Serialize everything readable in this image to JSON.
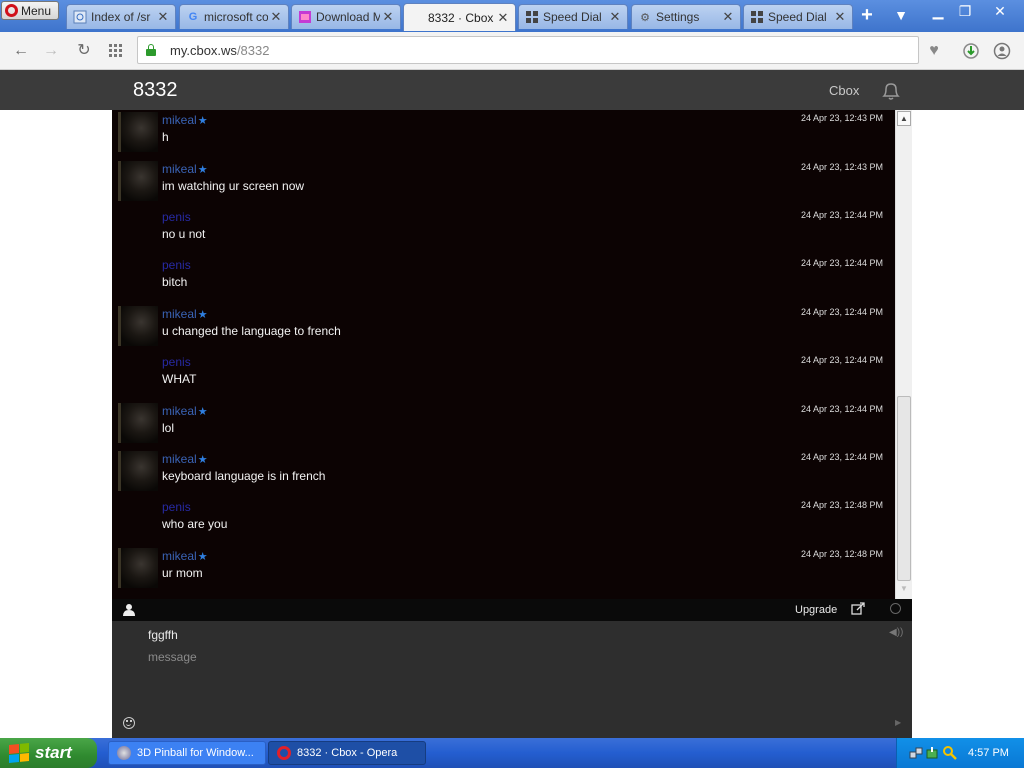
{
  "browser": {
    "menu_label": "Menu",
    "tabs": [
      {
        "title": "Index of /sr",
        "icon": "ie-page-icon"
      },
      {
        "title": "microsoft co",
        "icon": "google-icon"
      },
      {
        "title": "Download M",
        "icon": "download-page-icon"
      },
      {
        "title": "8332 · Cbox",
        "icon": "none"
      },
      {
        "title": "Speed Dial",
        "icon": "speed-dial-icon"
      },
      {
        "title": "Settings",
        "icon": "gear-icon"
      },
      {
        "title": "Speed Dial",
        "icon": "speed-dial-icon"
      }
    ],
    "url_host": "my.cbox.ws",
    "url_path": "/8332"
  },
  "cbox": {
    "box_title": "8332",
    "brand_link": "Cbox",
    "messages": [
      {
        "user": "mikeal",
        "registered": true,
        "text": "h",
        "time": "24 Apr 23, 12:43 PM"
      },
      {
        "user": "mikeal",
        "registered": true,
        "text": "im watching ur screen now",
        "time": "24 Apr 23, 12:43 PM"
      },
      {
        "user": "penis",
        "registered": false,
        "text": "no u not",
        "time": "24 Apr 23, 12:44 PM"
      },
      {
        "user": "penis",
        "registered": false,
        "text": "bitch",
        "time": "24 Apr 23, 12:44 PM"
      },
      {
        "user": "mikeal",
        "registered": true,
        "text": "u changed the language to french",
        "time": "24 Apr 23, 12:44 PM"
      },
      {
        "user": "penis",
        "registered": false,
        "text": "WHAT",
        "time": "24 Apr 23, 12:44 PM"
      },
      {
        "user": "mikeal",
        "registered": true,
        "text": "lol",
        "time": "24 Apr 23, 12:44 PM"
      },
      {
        "user": "mikeal",
        "registered": true,
        "text": "keyboard language is in french",
        "time": "24 Apr 23, 12:44 PM"
      },
      {
        "user": "penis",
        "registered": false,
        "text": "who are you",
        "time": "24 Apr 23, 12:48 PM"
      },
      {
        "user": "mikeal",
        "registered": true,
        "text": "ur mom",
        "time": "24 Apr 23, 12:48 PM"
      }
    ],
    "toolbar": {
      "upgrade_label": "Upgrade"
    },
    "form": {
      "name_value": "fggffh",
      "message_placeholder": "message"
    }
  },
  "taskbar": {
    "start_label": "start",
    "tasks": [
      {
        "label": "3D Pinball for Window..."
      },
      {
        "label": "8332 · Cbox - Opera"
      }
    ],
    "clock": "4:57 PM"
  },
  "colors": {
    "chat_bg": "#0c0303",
    "registered_name": "#3a63b5",
    "guest_name": "#272aa3",
    "header_bg": "#3b3b3b"
  }
}
